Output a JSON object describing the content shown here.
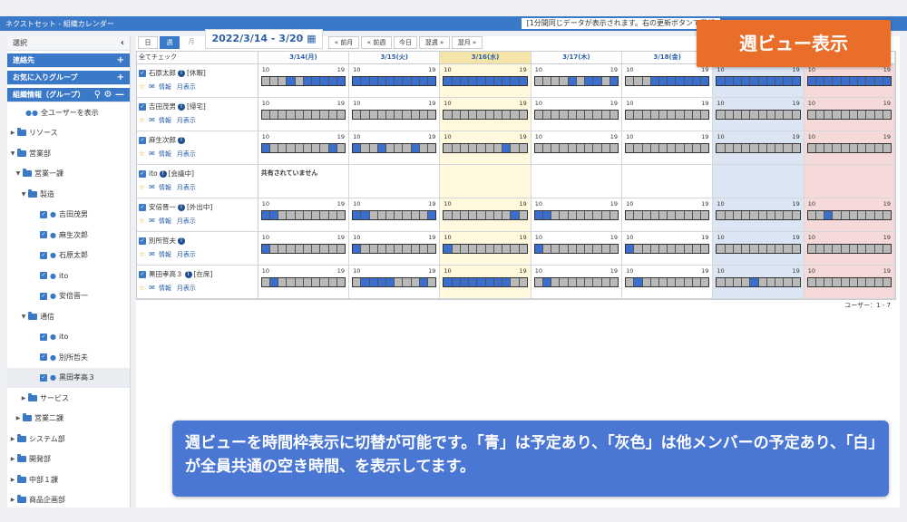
{
  "app": {
    "title": "ネクストセット - 組織カレンダー",
    "notice": "[1分間同じデータが表示されます。右の更新ボタンで最新"
  },
  "sidebar": {
    "select_label": "選択",
    "contacts_label": "連絡先",
    "favorites_label": "お気に入りグループ",
    "org_label": "組織情報（グループ）",
    "tree": [
      {
        "label": "全ユーザーを表示",
        "icon": "users-icon",
        "indent": 12,
        "caret": ""
      },
      {
        "label": "リソース",
        "icon": "folder-icon",
        "indent": 2,
        "caret": "▶"
      },
      {
        "label": "営業部",
        "icon": "folder-icon",
        "indent": 2,
        "caret": "▼"
      },
      {
        "label": "営業一課",
        "icon": "folder-icon",
        "indent": 8,
        "caret": "▼"
      },
      {
        "label": "製造",
        "icon": "folder-icon",
        "indent": 14,
        "caret": "▼"
      },
      {
        "label": "吉田茂男",
        "icon": "user-icon",
        "indent": 28,
        "caret": "",
        "checked": true
      },
      {
        "label": "麻生次郎",
        "icon": "user-icon",
        "indent": 28,
        "caret": "",
        "checked": true
      },
      {
        "label": "石原太郎",
        "icon": "user-icon",
        "indent": 28,
        "caret": "",
        "checked": true
      },
      {
        "label": "ito",
        "icon": "user-icon",
        "indent": 28,
        "caret": "",
        "checked": true
      },
      {
        "label": "安倍晋一",
        "icon": "user-icon",
        "indent": 28,
        "caret": "",
        "checked": true
      },
      {
        "label": "通信",
        "icon": "folder-icon",
        "indent": 14,
        "caret": "▼"
      },
      {
        "label": "ito",
        "icon": "user-icon",
        "indent": 28,
        "caret": "",
        "checked": true
      },
      {
        "label": "別所哲夫",
        "icon": "user-icon",
        "indent": 28,
        "caret": "",
        "checked": true
      },
      {
        "label": "黒田孝高３",
        "icon": "user-icon",
        "indent": 28,
        "caret": "",
        "checked": true,
        "selected": true
      },
      {
        "label": "サービス",
        "icon": "folder-icon",
        "indent": 14,
        "caret": "▶"
      },
      {
        "label": "営業二課",
        "icon": "folder-icon",
        "indent": 8,
        "caret": "▶"
      },
      {
        "label": "システム部",
        "icon": "folder-icon",
        "indent": 2,
        "caret": "▶"
      },
      {
        "label": "開発部",
        "icon": "folder-icon",
        "indent": 2,
        "caret": "▶"
      },
      {
        "label": "中部１課",
        "icon": "folder-icon",
        "indent": 2,
        "caret": "▶"
      },
      {
        "label": "商品企画部",
        "icon": "folder-icon",
        "indent": 2,
        "caret": "▶"
      }
    ]
  },
  "toolbar": {
    "day": "日",
    "week": "週",
    "month": "月",
    "date_range": "2022/3/14 - 3/20",
    "prev_month": "« 前月",
    "prev_week": "« 前週",
    "today": "今日",
    "next_week": "翌週 »",
    "next_month": "翌月 »"
  },
  "grid": {
    "check_all": "全てチェック",
    "days": [
      {
        "label": "3/14(月)",
        "kind": "weekday"
      },
      {
        "label": "3/15(火)",
        "kind": "weekday"
      },
      {
        "label": "3/16(水)",
        "kind": "today"
      },
      {
        "label": "3/17(木)",
        "kind": "weekday"
      },
      {
        "label": "3/18(金)",
        "kind": "weekday"
      },
      {
        "label": "",
        "kind": "sat"
      },
      {
        "label": "",
        "kind": "sun"
      }
    ],
    "hour_start": "10",
    "hour_end": "19",
    "info_label": "情報",
    "month_view_label": "月表示",
    "unshared_text": "共有されていません",
    "users": [
      {
        "name": "石原太郎",
        "status": "[休暇]",
        "slots": [
          "gggbgbbbbb",
          "bbbbbbbbbb",
          "bbbbbbbbbb",
          "ggggbgbbgb",
          "gggbbbbbbb",
          "bbbbbbbbbb",
          "bbbbbbbbbb"
        ]
      },
      {
        "name": "吉田茂男",
        "status": "[帰宅]",
        "slots": [
          "gggggggggg",
          "gggggggggg",
          "gggggggggg",
          "gggggggggg",
          "gggggggggg",
          "gggggggggg",
          "gggggggggg"
        ]
      },
      {
        "name": "麻生次郎",
        "status": "",
        "slots": [
          "bgggggggbg",
          "bggbgggbgg",
          "gggggggbgg",
          "gggggggggg",
          "gggggggggg",
          "gggggggggg",
          "gggggggggg"
        ]
      },
      {
        "name": "ito",
        "status": "[会議中]",
        "slots": null
      },
      {
        "name": "安倍晋一",
        "status": "[外出中]",
        "slots": [
          "bbgggggggg",
          "bbgggggggb",
          "ggggggggbg",
          "bbgggggggg",
          "gggggggggg",
          "gggggggggg",
          "ggbggggggg"
        ]
      },
      {
        "name": "別所哲夫",
        "status": "",
        "slots": [
          "bggggggggg",
          "bggggggggg",
          "bggggggggg",
          "bggggggggg",
          "bggggggggg",
          "gggggggggg",
          "gggggggggg"
        ]
      },
      {
        "name": "黒田孝高３",
        "status": "[在席]",
        "slots": [
          "gbgggggggg",
          "gbbbbgggbg",
          "bbbbbbbbgg",
          "gbgggggggg",
          "gbgggggggg",
          "ggggbggggg",
          "gggggggggg"
        ]
      }
    ],
    "user_count": "ユーザー：1 - 7"
  },
  "overlays": {
    "top_label": "週ビュー表示",
    "bottom_text": "週ビューを時間枠表示に切替が可能です。「青」は予定あり、「灰色」は他メンバーの予定あり、「白」が全員共通の空き時間、を表示してます。"
  },
  "colors": {
    "accent": "#3a78c8",
    "busy_blue": "#3a6fd0",
    "others_gray": "#b9b9b9",
    "free_white": "#ffffff",
    "today_header": "#f5e4a8",
    "banner_orange": "#e96e2a",
    "banner_blue": "#4a76d4"
  }
}
